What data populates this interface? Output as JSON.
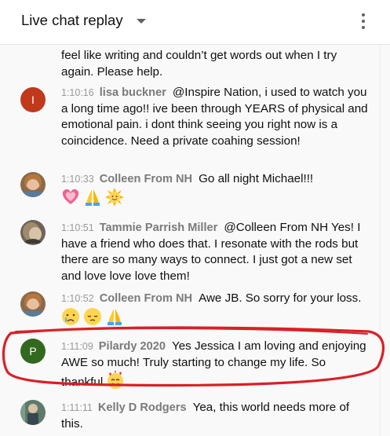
{
  "header": {
    "title": "Live chat replay"
  },
  "messages": [
    {
      "timestamp": "",
      "author": "",
      "text": "feel like writing and couldn’t get words out when I try again. Please help."
    },
    {
      "timestamp": "1:10:16",
      "author": "lisa buckner",
      "avatar_letter": "I",
      "avatar_color": "#c0391b",
      "text": "@Inspire Nation, i used to watch you a long time ago!! ive been through YEARS of physical and emotional pain. i dont think seeing you right now is a coincidence. Need a private coahing session!"
    },
    {
      "timestamp": "1:10:33",
      "author": "Colleen From NH",
      "text": "Go all night Michael!!!",
      "emojis": [
        "growing-heart",
        "folded-hands",
        "sun-with-face"
      ]
    },
    {
      "timestamp": "1:10:51",
      "author": "Tammie Parrish Miller",
      "text": "@Colleen From NH Yes! I have a friend who does that. I resonate with the rods but there are so many ways to connect. I just got a new set and love love love them!"
    },
    {
      "timestamp": "1:10:52",
      "author": "Colleen From NH",
      "text": "Awe JB. So sorry for your loss.",
      "emojis": [
        "crying-face",
        "pensive-face",
        "folded-hands"
      ]
    },
    {
      "timestamp": "1:11:09",
      "author": "Pilardy 2020",
      "avatar_letter": "P",
      "avatar_color": "#33691e",
      "text": "Yes Jessica I am loving and enjoying AWE so much! Truly starting to change my life. So thankful",
      "emojis": [
        "smiling-face-with-hearts"
      ]
    },
    {
      "timestamp": "1:11:11",
      "author": "Kelly D Rodgers",
      "text": "Yea, this world needs more of this."
    }
  ],
  "colors": {
    "timestamp": "#999999",
    "author": "#7a7a7a",
    "highlight_ring": "#d92027",
    "chat_background": "#f9f9f9"
  }
}
